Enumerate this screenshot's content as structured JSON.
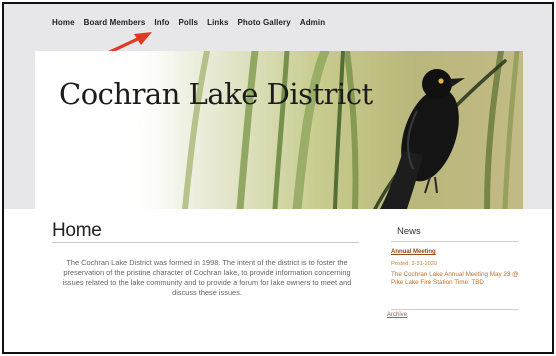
{
  "nav": {
    "items": [
      {
        "label": "Home"
      },
      {
        "label": "Board Members"
      },
      {
        "label": "Info"
      },
      {
        "label": "Polls"
      },
      {
        "label": "Links"
      },
      {
        "label": "Photo Gallery"
      },
      {
        "label": "Admin"
      }
    ]
  },
  "annotation": {
    "arrow_color": "#e23a22"
  },
  "banner": {
    "title": "Cochran Lake District"
  },
  "main": {
    "heading": "Home",
    "intro": "The Cochran Lake District was formed in 1998.  The intent of the district is to foster the preservation of the pristine character of Cochran lake, to provide information concerning issues related to the lake community and to provide a forum for lake owners to meet and discuss these issues."
  },
  "news": {
    "title": "News",
    "item": {
      "title": "Annual Meeting",
      "posted": "Posted: 3-31-2020",
      "body": "The Cochran Lake Annual Meeting May 23 @ Pike Lake Fire Station Time: TBD"
    },
    "archive_label": "Archive"
  },
  "colors": {
    "page_bg": "#e7e7e9",
    "news_link": "#9a4b14",
    "news_text": "#c2712e"
  }
}
